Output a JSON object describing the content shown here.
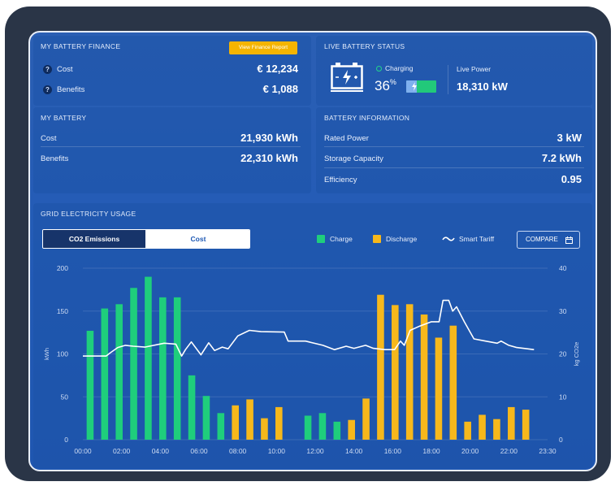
{
  "finance": {
    "title": "MY BATTERY FINANCE",
    "report_button": "View Finance Report",
    "rows": [
      {
        "label": "Cost",
        "value": "€ 12,234"
      },
      {
        "label": "Benefits",
        "value": "€ 1,088"
      }
    ]
  },
  "my_battery": {
    "title": "MY BATTERY",
    "rows": [
      {
        "label": "Cost",
        "value": "21,930 kWh"
      },
      {
        "label": "Benefits",
        "value": "22,310 kWh"
      }
    ]
  },
  "live_status": {
    "title": "LIVE BATTERY STATUS",
    "charging_label": "Charging",
    "percent": "36",
    "percent_unit": "%",
    "charge_level": 0.36,
    "live_power_label": "Live Power",
    "live_power_value": "18,310 kW"
  },
  "battery_info": {
    "title": "BATTERY INFORMATION",
    "rows": [
      {
        "label": "Rated Power",
        "value": "3 kW"
      },
      {
        "label": "Storage Capacity",
        "value": "7.2 kWh"
      },
      {
        "label": "Efficiency",
        "value": "0.95"
      }
    ]
  },
  "grid": {
    "title": "GRID ELECTRICITY USAGE",
    "tabs": [
      "CO2 Emissions",
      "Cost"
    ],
    "active_tab": "Cost",
    "legend": [
      "Charge",
      "Discharge",
      "Smart Tariff"
    ],
    "compare_label": "COMPARE"
  },
  "colors": {
    "charge": "#1fce7c",
    "discharge": "#f6b81c",
    "tariff": "#ffffff",
    "accent": "#f5b400"
  },
  "chart_data": {
    "type": "bar",
    "x_tick_labels": [
      "00:00",
      "02:00",
      "04:00",
      "06:00",
      "08:00",
      "10:00",
      "12:00",
      "14:00",
      "16:00",
      "18:00",
      "20:00",
      "22:00",
      "23:30"
    ],
    "ylabel": "kWh",
    "y2label": "kg CO2e",
    "ylim": [
      0,
      200
    ],
    "y2lim": [
      0,
      40
    ],
    "y_ticks": [
      0,
      50,
      100,
      150,
      200
    ],
    "y2_ticks": [
      0,
      10,
      20,
      30,
      40
    ],
    "series": [
      {
        "name": "Charge",
        "type": "bar",
        "values": [
          127,
          153,
          158,
          177,
          190,
          166,
          166,
          75,
          51,
          31,
          null,
          null,
          null,
          null,
          null,
          28,
          31,
          21,
          null,
          null,
          null,
          null,
          null,
          null,
          null,
          null,
          null,
          null,
          null,
          null,
          null,
          null
        ]
      },
      {
        "name": "Discharge",
        "type": "bar",
        "values": [
          null,
          null,
          null,
          null,
          null,
          null,
          null,
          null,
          null,
          null,
          40,
          47,
          25,
          38,
          null,
          null,
          null,
          null,
          23,
          48,
          169,
          157,
          158,
          146,
          119,
          133,
          21,
          29,
          24,
          38,
          35,
          null
        ]
      },
      {
        "name": "Smart Tariff",
        "type": "line",
        "axis": "right",
        "points": [
          [
            0,
            19.5
          ],
          [
            1.2,
            19.5
          ],
          [
            1.4,
            20.2
          ],
          [
            1.8,
            21.5
          ],
          [
            2.2,
            22
          ],
          [
            2.6,
            21.8
          ],
          [
            3.2,
            21.6
          ],
          [
            4.2,
            22.5
          ],
          [
            4.8,
            22.3
          ],
          [
            5.1,
            19.5
          ],
          [
            5.3,
            21
          ],
          [
            5.6,
            22.8
          ],
          [
            6.1,
            19.8
          ],
          [
            6.5,
            22.6
          ],
          [
            6.8,
            20.8
          ],
          [
            7.2,
            21.6
          ],
          [
            7.5,
            21.2
          ],
          [
            8,
            24.2
          ],
          [
            8.6,
            25.5
          ],
          [
            9.2,
            25.2
          ],
          [
            10.4,
            25.1
          ],
          [
            10.6,
            23
          ],
          [
            11.5,
            23
          ],
          [
            12.4,
            22
          ],
          [
            13,
            21
          ],
          [
            13.6,
            21.8
          ],
          [
            14,
            21.3
          ],
          [
            14.6,
            22
          ],
          [
            15,
            21.3
          ],
          [
            15.6,
            21
          ],
          [
            16.1,
            21
          ],
          [
            16.4,
            23
          ],
          [
            16.6,
            22
          ],
          [
            16.9,
            25.5
          ],
          [
            17.4,
            26.5
          ],
          [
            18,
            27.5
          ],
          [
            18.4,
            27.5
          ],
          [
            18.6,
            32.5
          ],
          [
            18.9,
            32.5
          ],
          [
            19.1,
            30
          ],
          [
            19.3,
            31
          ],
          [
            19.7,
            27.5
          ],
          [
            20.2,
            23.5
          ],
          [
            20.8,
            23
          ],
          [
            21.4,
            22.5
          ],
          [
            21.6,
            23
          ],
          [
            22,
            22
          ],
          [
            22.4,
            21.5
          ],
          [
            23.3,
            21
          ]
        ]
      }
    ]
  }
}
